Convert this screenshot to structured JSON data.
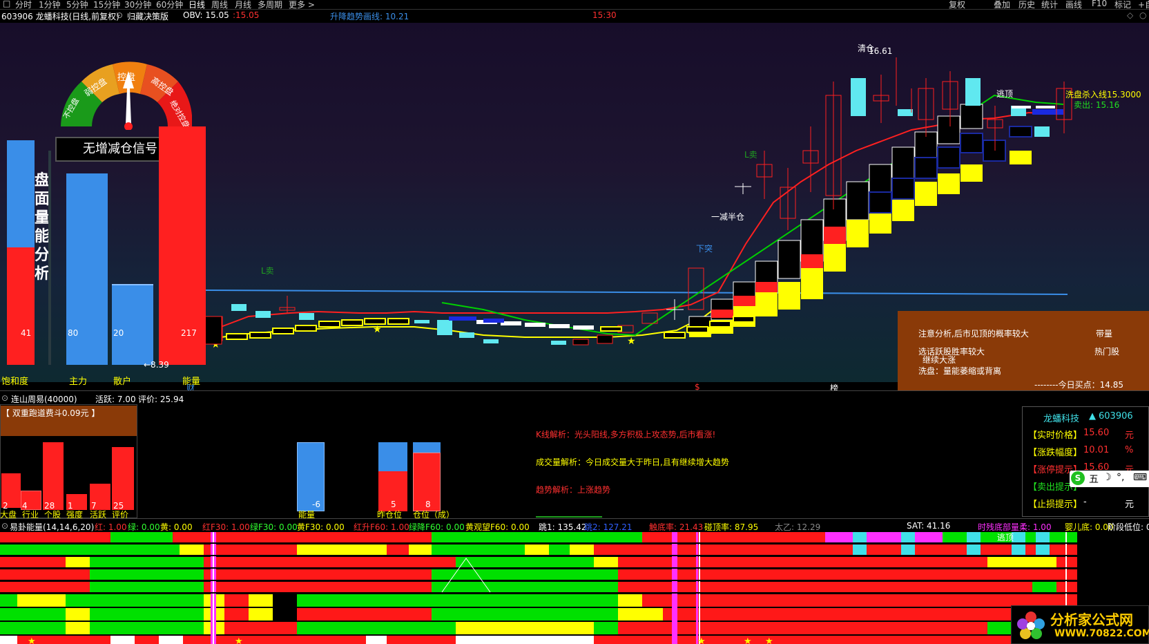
{
  "topbar": {
    "timeframes": [
      "分时",
      "1分钟",
      "5分钟",
      "15分钟",
      "30分钟",
      "60分钟",
      "日线",
      "周线",
      "月线",
      "多周期",
      "更多 >"
    ],
    "active_timeframe": "日线",
    "tools": [
      "复权",
      "叠加",
      "历史",
      "统计",
      "画线",
      "F10",
      "标记",
      "+自"
    ]
  },
  "infobar": {
    "stock": "603906 龙蟠科技(日线,前复权)",
    "strategy": "归藏决策版",
    "obv_label": "OBV: 15.05",
    "obv_value": "15.05",
    "trend_label": "升降趋势画线: 10.21",
    "time": "15:30"
  },
  "gauge": {
    "segments": [
      "不控盘",
      "弱控盘",
      "控盘",
      "高控盘",
      "绝对控盘"
    ],
    "signal": "无增减仓信号"
  },
  "volume_analysis": {
    "title": "盘面量能分析",
    "bars": [
      {
        "label": "饱和度",
        "value": "41"
      },
      {
        "label": "主力",
        "value": "80"
      },
      {
        "label": "散户",
        "value": "20"
      },
      {
        "label": "能量",
        "value": "217"
      }
    ],
    "arrow_note": "←8.39"
  },
  "chart_annotations": {
    "high_price": "16.61",
    "clear_label": "清仓",
    "reduce_half": "一减半仓",
    "xia_tu": "下突",
    "l_sell": "L卖",
    "escape_top": "逃顶",
    "wash_buy": "洗盘杀入线15.3000",
    "sell_out": "卖出: 15.16",
    "sell_low_left": "L卖"
  },
  "axis_markers": [
    "财",
    "$",
    "榜"
  ],
  "notebox": {
    "line1": "注意分析,后市见顶的概率较大",
    "line1_right": "带量",
    "line2": "选话跃股胜率较大",
    "line2_right": "热门股",
    "line3": "继续大涨",
    "line4": "洗盘：量能萎缩或背离",
    "line5": "--------今日买点：14.85"
  },
  "panel2bar": {
    "name": "连山周易(40000)",
    "active": "活跃: 7.00",
    "rating": "评价: 25.94"
  },
  "panel2": {
    "header": "【 双重跑道费斗0.09元 】",
    "small_bars": [
      {
        "label": "大盘",
        "value": "2"
      },
      {
        "label": "行业",
        "value": "4"
      },
      {
        "label": "个股",
        "value": "28"
      },
      {
        "label": "强度",
        "value": "1"
      },
      {
        "label": "活跃",
        "value": "7"
      },
      {
        "label": "评价",
        "value": "25"
      }
    ],
    "mid_bars": [
      {
        "label": "能量",
        "value": "-6"
      },
      {
        "label": "昨仓位",
        "value": "5"
      },
      {
        "label": "仓位（成）",
        "value": "8"
      }
    ],
    "analysis_k": "K线解析：光头阳线,多方积极上攻态势,后市看涨!",
    "analysis_vol": "成交量解析：今日成交量大于昨日,且有继续增大趋势",
    "analysis_trend": "趋势解析：上涨趋势"
  },
  "infobox": {
    "name": "龙蟠科技",
    "code": "603906",
    "rows": [
      {
        "key": "【实时价格】",
        "value": "15.60",
        "unit": "元"
      },
      {
        "key": "【涨跌幅度】",
        "value": "10.01",
        "unit": "%"
      },
      {
        "key": "【涨停提示】",
        "value": "15.60",
        "unit": "元"
      },
      {
        "key": "【卖出提示】",
        "value": "",
        "unit": ""
      },
      {
        "key": "【止损提示】",
        "value": "-",
        "unit": "元"
      }
    ],
    "ime": "五"
  },
  "panel3bar": {
    "name": "易卦能量(14,14,6,20)",
    "items": [
      {
        "text": "红: 1.00",
        "color": "#ff3030"
      },
      {
        "text": "绿: 0.00",
        "color": "#30ff30"
      },
      {
        "text": "黄: 0.00",
        "color": "#ffff00"
      },
      {
        "text": "红F30: 1.00",
        "color": "#ff3030"
      },
      {
        "text": "绿F30: 0.00",
        "color": "#30ff30"
      },
      {
        "text": "黄F30: 0.00",
        "color": "#ffff00"
      },
      {
        "text": "红升F60: 1.00",
        "color": "#ff3030"
      },
      {
        "text": "绿降F60: 0.00",
        "color": "#30ff30"
      },
      {
        "text": "黄观望F60: 0.00",
        "color": "#ffff00"
      },
      {
        "text": "跳1: 135.42",
        "color": "#ffffff"
      },
      {
        "text": "跳2: 127.21",
        "color": "#3060ff"
      },
      {
        "text": "触底率: 21.43",
        "color": "#ff3030"
      },
      {
        "text": "碰顶率: 87.95",
        "color": "#ffff00"
      },
      {
        "text": "太乙: 12.29",
        "color": "#888888"
      },
      {
        "text": "SAT: 41.16",
        "color": "#ffffff"
      },
      {
        "text": "时残底部量柔: 1.00",
        "color": "#ff30ff"
      },
      {
        "text": "婴儿底: 0.00",
        "color": "#ffff00"
      },
      {
        "text": "阶段低位: 0",
        "color": "#ffffff"
      }
    ],
    "escape_label": "逃顶"
  },
  "watermark": {
    "title": "分析家公式网",
    "url": "WWW.70822.COM"
  },
  "colors": {
    "up": "#ff2020",
    "down": "#60e8f0",
    "yellow": "#ffff00",
    "green": "#00e000",
    "blue": "#3a8ee8"
  }
}
